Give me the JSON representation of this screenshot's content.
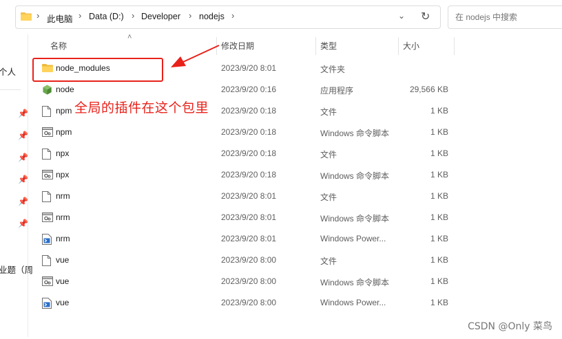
{
  "address": {
    "crumbs": [
      "此电脑",
      "Data (D:)",
      "Developer",
      "nodejs"
    ],
    "separator": "›",
    "dropdown_glyph": "⌄",
    "refresh_glyph": "↻"
  },
  "search": {
    "placeholder": "在 nodejs 中搜索"
  },
  "nav": {
    "partial_items": [
      "个人",
      "业题（周"
    ],
    "pin_glyph": "📌"
  },
  "columns": {
    "sort_glyph": "˄",
    "name": "名称",
    "date": "修改日期",
    "type": "类型",
    "size": "大小"
  },
  "files": [
    {
      "name": "node_modules",
      "date": "2023/9/20 8:01",
      "type": "文件夹",
      "size": "",
      "icon": "folder-icon"
    },
    {
      "name": "node",
      "date": "2023/9/20 0:16",
      "type": "应用程序",
      "size": "29,566 KB",
      "icon": "node-app-icon"
    },
    {
      "name": "npm",
      "date": "2023/9/20 0:18",
      "type": "文件",
      "size": "1 KB",
      "icon": "file-icon"
    },
    {
      "name": "npm",
      "date": "2023/9/20 0:18",
      "type": "Windows 命令脚本",
      "size": "1 KB",
      "icon": "script-icon"
    },
    {
      "name": "npx",
      "date": "2023/9/20 0:18",
      "type": "文件",
      "size": "1 KB",
      "icon": "file-icon"
    },
    {
      "name": "npx",
      "date": "2023/9/20 0:18",
      "type": "Windows 命令脚本",
      "size": "1 KB",
      "icon": "script-icon"
    },
    {
      "name": "nrm",
      "date": "2023/9/20 8:01",
      "type": "文件",
      "size": "1 KB",
      "icon": "file-icon"
    },
    {
      "name": "nrm",
      "date": "2023/9/20 8:01",
      "type": "Windows 命令脚本",
      "size": "1 KB",
      "icon": "script-icon"
    },
    {
      "name": "nrm",
      "date": "2023/9/20 8:01",
      "type": "Windows Power...",
      "size": "1 KB",
      "icon": "powershell-icon"
    },
    {
      "name": "vue",
      "date": "2023/9/20 8:00",
      "type": "文件",
      "size": "1 KB",
      "icon": "file-icon"
    },
    {
      "name": "vue",
      "date": "2023/9/20 8:00",
      "type": "Windows 命令脚本",
      "size": "1 KB",
      "icon": "script-icon"
    },
    {
      "name": "vue",
      "date": "2023/9/20 8:00",
      "type": "Windows Power...",
      "size": "1 KB",
      "icon": "powershell-icon"
    }
  ],
  "annotation": {
    "text": "全局的插件在这个包里",
    "color": "#e8211a"
  },
  "watermark": "CSDN @Only 菜鸟"
}
